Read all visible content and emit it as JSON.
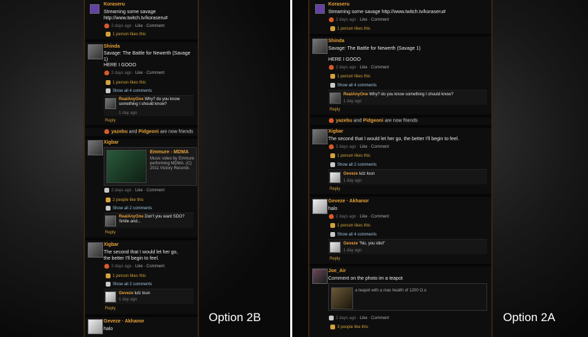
{
  "labels": {
    "left": "Option 2B",
    "right": "Option 2A"
  },
  "common": {
    "like_meta": "Like · Comment",
    "reply": "Reply",
    "show_all_4": "Show all 4 comments",
    "show_all_2": "Show all 2 comments",
    "likes_1": "1 person likes this",
    "likes_2": "2 people like this",
    "likes_3": "3 people like this",
    "one_day_ago": "1 day ago",
    "two_days_ago": "2 days ago"
  },
  "left": {
    "posts": [
      {
        "name": "Koraseru",
        "text": "Streaming some savage http://www.twitch.tv/koraseru#"
      },
      {
        "name": "Shinda",
        "text": "Savage: The Battle for Newerth (Savage 1)",
        "text2": "HERE I GOOO",
        "comment_author": "RealAnyOne",
        "comment_text": "Why? do you know something I should know?"
      },
      {
        "friends_a": "yazebu",
        "friends_b": "Pidgeoni",
        "friends_text": "are now friends"
      },
      {
        "name": "Xigbar",
        "media_title": "Emmure - MDMA",
        "media_desc": "Music video by Emmure performing MDMA. (C) 2011 Victory Records",
        "comment_author": "RealAnyOne",
        "comment_text": "Don't you want SDO? Smile and..."
      },
      {
        "name": "Xigbar",
        "text": "The second that I would let her go, the better I'll begin to feel.",
        "comment_author": "Geveze",
        "comment_text": "lutz loun"
      },
      {
        "name": "Geveze · Akhanor",
        "text": "halo"
      }
    ]
  },
  "right": {
    "posts": [
      {
        "name": "Koraseru",
        "text": "Streaming some savage http://www.twitch.tv/koraseru#"
      },
      {
        "name": "Shinda",
        "text": "Savage: The Battle for Newerth (Savage 1)",
        "text2": "HERE I GOOO",
        "comment_author": "RealAnyOne",
        "comment_text": "Why? do you know something I should know?"
      },
      {
        "friends_a": "yazebu",
        "friends_b": "Pidgeoni",
        "friends_text": "are now friends"
      },
      {
        "name": "Xigbar",
        "text": "The second that I would let her go, the better I'll begin to feel.",
        "comment_author": "Geveze",
        "comment_text": "lutz loun"
      },
      {
        "name": "Geveze · Akhanor",
        "text": "halo",
        "comment_author": "Geveze",
        "comment_text": "\"No, you idiot\""
      },
      {
        "name": "Joe_Air",
        "text": "Comment on the photo im a teapot",
        "photo_caption": "a teapot with a max health of 1200 O.o"
      }
    ]
  }
}
